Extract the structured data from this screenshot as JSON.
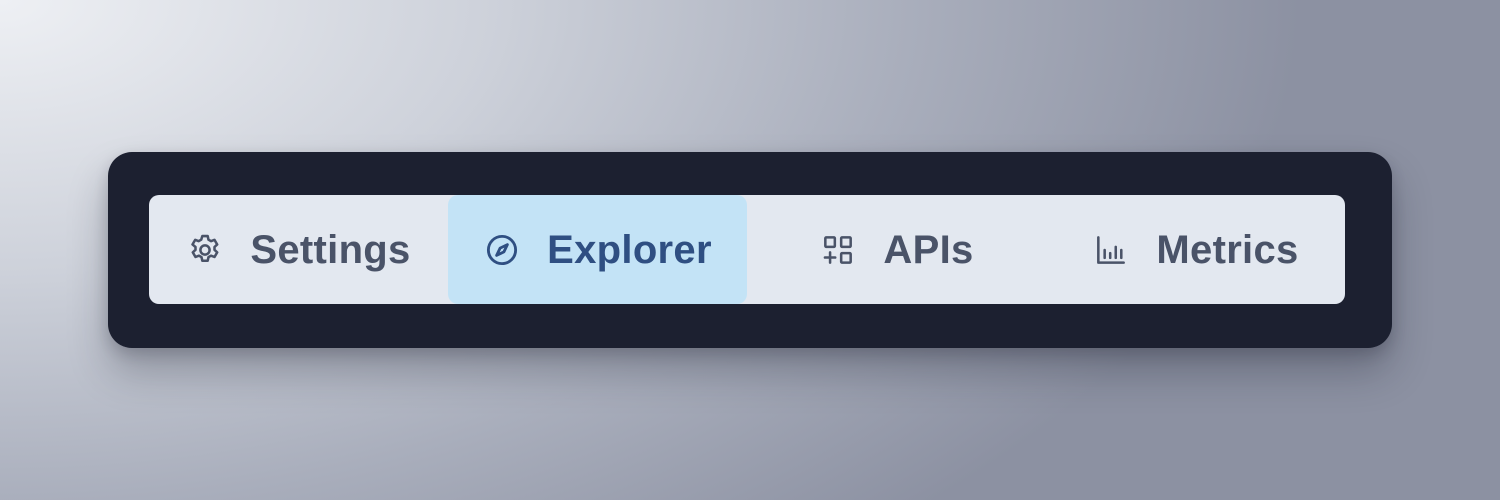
{
  "tab_bar": {
    "tabs": [
      {
        "label": "Settings",
        "icon": "gear-icon",
        "selected": false
      },
      {
        "label": "Explorer",
        "icon": "compass-icon",
        "selected": true
      },
      {
        "label": "APIs",
        "icon": "grid-plus-icon",
        "selected": false
      },
      {
        "label": "Metrics",
        "icon": "bar-chart-icon",
        "selected": false
      }
    ]
  },
  "colors": {
    "frame": "#1c2030",
    "tab_bar": "#e3e8f0",
    "active_tab": "#c3e3f6",
    "active_text": "#2f4f82",
    "inactive_text": "#4a5368"
  }
}
